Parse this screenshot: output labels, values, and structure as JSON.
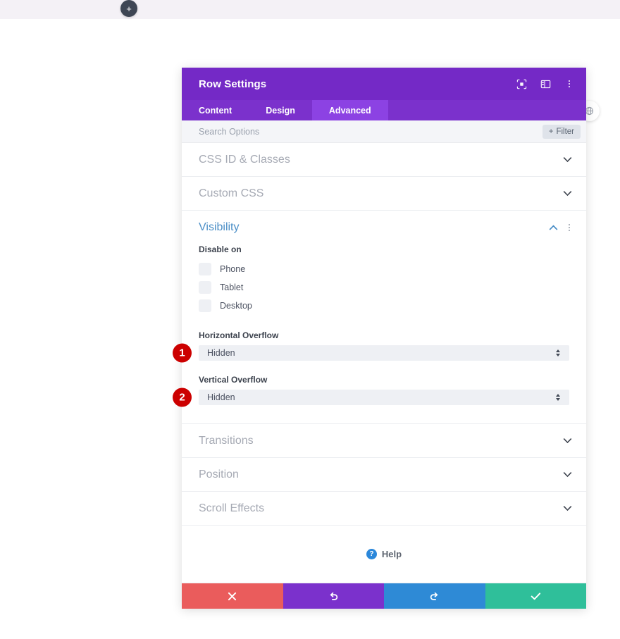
{
  "canvas": {
    "add_button_label": "+",
    "add_button_icon": "plus-icon",
    "side_button_icon": "globe-icon"
  },
  "modal": {
    "title": "Row Settings",
    "header_icons": [
      {
        "name": "focus-target-icon",
        "title": "Focus"
      },
      {
        "name": "layout-panel-icon",
        "title": "Layout"
      },
      {
        "name": "more-vertical-icon",
        "title": "More"
      }
    ],
    "tabs": [
      {
        "label": "Content",
        "active": false
      },
      {
        "label": "Design",
        "active": false
      },
      {
        "label": "Advanced",
        "active": true
      }
    ],
    "search": {
      "placeholder": "Search Options",
      "value": ""
    },
    "filter_button": {
      "label": "Filter",
      "icon": "plus-icon"
    },
    "sections": [
      {
        "label": "CSS ID & Classes",
        "state": "collapsed",
        "icon": "chevron-down-icon"
      },
      {
        "label": "Custom CSS",
        "state": "collapsed",
        "icon": "chevron-down-icon"
      }
    ],
    "visibility": {
      "label": "Visibility",
      "state": "expanded",
      "collapse_icon": "chevron-up-icon",
      "menu_icon": "more-vertical-icon",
      "disable_on": {
        "label": "Disable on",
        "options": [
          {
            "label": "Phone",
            "checked": false
          },
          {
            "label": "Tablet",
            "checked": false
          },
          {
            "label": "Desktop",
            "checked": false
          }
        ]
      },
      "horizontal_overflow": {
        "label": "Horizontal Overflow",
        "value": "Hidden",
        "badge": "1"
      },
      "vertical_overflow": {
        "label": "Vertical Overflow",
        "value": "Hidden",
        "badge": "2"
      }
    },
    "sections_bottom": [
      {
        "label": "Transitions",
        "state": "collapsed",
        "icon": "chevron-down-icon"
      },
      {
        "label": "Position",
        "state": "collapsed",
        "icon": "chevron-down-icon"
      },
      {
        "label": "Scroll Effects",
        "state": "collapsed",
        "icon": "chevron-down-icon"
      }
    ],
    "help": {
      "label": "Help",
      "icon": "question-circle-icon"
    },
    "footer": [
      {
        "name": "cancel-button",
        "icon": "close-x-icon",
        "color": "#ea5c5c"
      },
      {
        "name": "undo-button",
        "icon": "undo-icon",
        "color": "#7b31cc"
      },
      {
        "name": "redo-button",
        "icon": "redo-icon",
        "color": "#2e8ad6"
      },
      {
        "name": "save-button",
        "icon": "checkmark-icon",
        "color": "#2fbf9a"
      }
    ]
  },
  "colors": {
    "header_purple": "#7429c6",
    "tab_purple": "#7b31cc",
    "tab_active_purple": "#8c42e3",
    "badge_red": "#cc0000",
    "link_blue": "#4c8fc7"
  }
}
